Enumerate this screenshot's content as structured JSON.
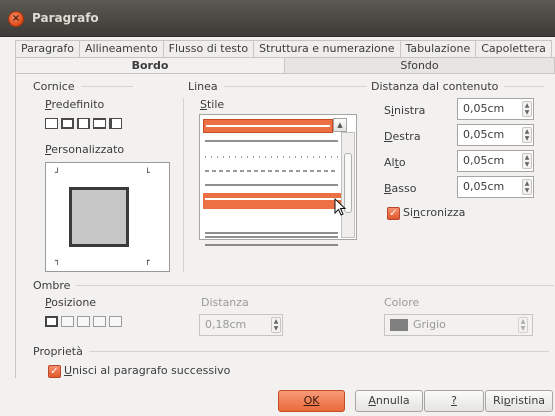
{
  "window": {
    "title": "Paragrafo"
  },
  "tabs_row1": [
    "Paragrafo",
    "Allineamento",
    "Flusso di testo",
    "Struttura e numerazione",
    "Tabulazione",
    "Capolettera"
  ],
  "tabs_row2": [
    "Bordo",
    "Sfondo"
  ],
  "cornice": {
    "title": "Cornice",
    "predefinito_label": "Predefinito",
    "personalizzato_label": "Personalizzato"
  },
  "linea": {
    "title": "Linea",
    "stile_label": "Stile"
  },
  "distanza": {
    "title": "Distanza dal contenuto",
    "sinistra_label": "Sinistra",
    "sinistra_value": "0,05cm",
    "destra_label": "Destra",
    "destra_value": "0,05cm",
    "alto_label": "Alto",
    "alto_value": "0,05cm",
    "basso_label": "Basso",
    "basso_value": "0,05cm",
    "sincronizza_label": "Sincronizza"
  },
  "ombre": {
    "title": "Ombre",
    "posizione_label": "Posizione",
    "distanza_label": "Distanza",
    "distanza_value": "0,18cm",
    "colore_label": "Colore",
    "colore_value": "Grigio"
  },
  "proprieta": {
    "title": "Proprietà",
    "unisci_label": "Unisci al paragrafo successivo"
  },
  "buttons": {
    "ok": "OK",
    "annulla": "Annulla",
    "help": "?",
    "ripristina": "Ripristina"
  },
  "colors": {
    "accent": "#ec7043",
    "titlebar": "#3c3b37",
    "dialog_bg": "#f2f1f0"
  }
}
